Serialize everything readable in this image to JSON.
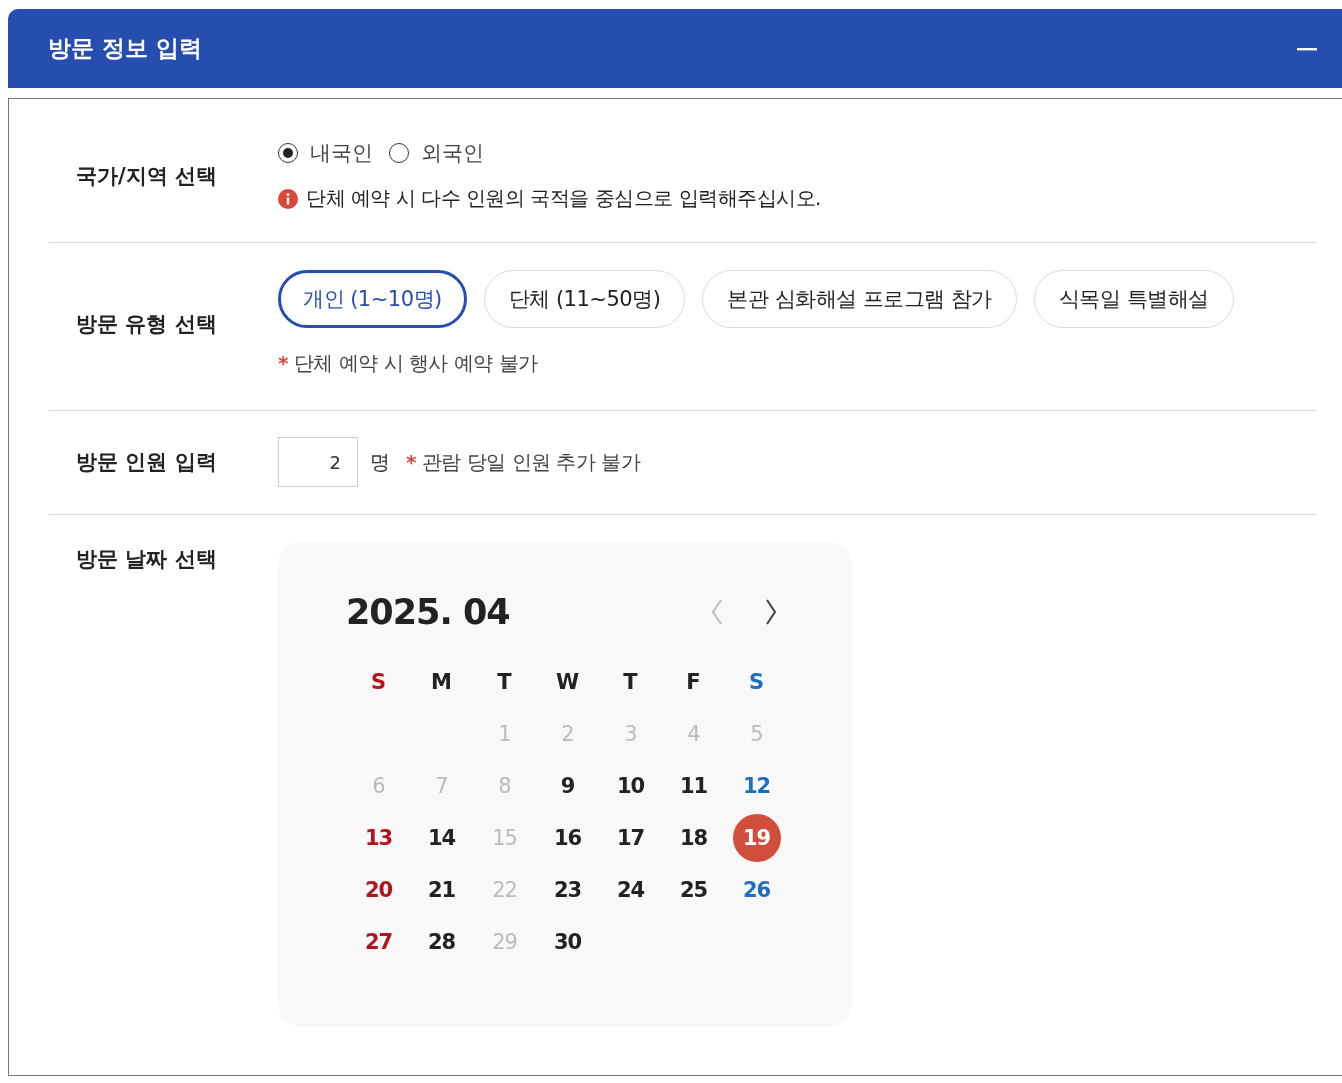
{
  "panel": {
    "title": "방문 정보 입력",
    "expanded": true
  },
  "nationality": {
    "label": "국가/지역 선택",
    "options": [
      {
        "label": "내국인",
        "selected": true
      },
      {
        "label": "외국인",
        "selected": false
      }
    ],
    "notice": "단체 예약 시 다수 인원의 국적을 중심으로 입력해주십시오."
  },
  "visit_type": {
    "label": "방문 유형 선택",
    "options": [
      {
        "label": "개인 (1~10명)",
        "selected": true
      },
      {
        "label": "단체 (11~50명)",
        "selected": false
      },
      {
        "label": "본관 심화해설 프로그램 참가",
        "selected": false
      },
      {
        "label": "식목일 특별해설",
        "selected": false
      }
    ],
    "note": {
      "marker": "*",
      "text": "단체 예약 시 행사 예약 불가"
    }
  },
  "visitors": {
    "label": "방문 인원 입력",
    "value": "2",
    "unit": "명",
    "note": {
      "marker": "*",
      "text": "관람 당일 인원 추가 불가"
    }
  },
  "visit_date": {
    "label": "방문 날짜 선택",
    "calendar": {
      "title": "2025. 04",
      "prev": {
        "disabled": true
      },
      "next": {
        "disabled": false
      },
      "weekdays": [
        {
          "label": "S",
          "kind": "sunday"
        },
        {
          "label": "M",
          "kind": "weekday"
        },
        {
          "label": "T",
          "kind": "weekday"
        },
        {
          "label": "W",
          "kind": "weekday"
        },
        {
          "label": "T",
          "kind": "weekday"
        },
        {
          "label": "F",
          "kind": "weekday"
        },
        {
          "label": "S",
          "kind": "saturday"
        }
      ],
      "days": [
        {
          "kind": "blank"
        },
        {
          "kind": "blank"
        },
        {
          "day": "1",
          "kind": "weekday",
          "disabled": true,
          "selected": false
        },
        {
          "day": "2",
          "kind": "weekday",
          "disabled": true,
          "selected": false
        },
        {
          "day": "3",
          "kind": "weekday",
          "disabled": true,
          "selected": false
        },
        {
          "day": "4",
          "kind": "weekday",
          "disabled": true,
          "selected": false
        },
        {
          "day": "5",
          "kind": "saturday",
          "disabled": true,
          "selected": false
        },
        {
          "day": "6",
          "kind": "sunday",
          "disabled": true,
          "selected": false
        },
        {
          "day": "7",
          "kind": "weekday",
          "disabled": true,
          "selected": false
        },
        {
          "day": "8",
          "kind": "weekday",
          "disabled": true,
          "selected": false
        },
        {
          "day": "9",
          "kind": "weekday",
          "disabled": false,
          "selected": false
        },
        {
          "day": "10",
          "kind": "weekday",
          "disabled": false,
          "selected": false
        },
        {
          "day": "11",
          "kind": "weekday",
          "disabled": false,
          "selected": false
        },
        {
          "day": "12",
          "kind": "saturday",
          "disabled": false,
          "selected": false
        },
        {
          "day": "13",
          "kind": "sunday",
          "disabled": false,
          "selected": false
        },
        {
          "day": "14",
          "kind": "weekday",
          "disabled": false,
          "selected": false
        },
        {
          "day": "15",
          "kind": "weekday",
          "disabled": true,
          "selected": false
        },
        {
          "day": "16",
          "kind": "weekday",
          "disabled": false,
          "selected": false
        },
        {
          "day": "17",
          "kind": "weekday",
          "disabled": false,
          "selected": false
        },
        {
          "day": "18",
          "kind": "weekday",
          "disabled": false,
          "selected": false
        },
        {
          "day": "19",
          "kind": "saturday",
          "disabled": false,
          "selected": true
        },
        {
          "day": "20",
          "kind": "sunday",
          "disabled": false,
          "selected": false
        },
        {
          "day": "21",
          "kind": "weekday",
          "disabled": false,
          "selected": false
        },
        {
          "day": "22",
          "kind": "weekday",
          "disabled": true,
          "selected": false
        },
        {
          "day": "23",
          "kind": "weekday",
          "disabled": false,
          "selected": false
        },
        {
          "day": "24",
          "kind": "weekday",
          "disabled": false,
          "selected": false
        },
        {
          "day": "25",
          "kind": "weekday",
          "disabled": false,
          "selected": false
        },
        {
          "day": "26",
          "kind": "saturday",
          "disabled": false,
          "selected": false
        },
        {
          "day": "27",
          "kind": "sunday",
          "disabled": false,
          "selected": false
        },
        {
          "day": "28",
          "kind": "weekday",
          "disabled": false,
          "selected": false
        },
        {
          "day": "29",
          "kind": "weekday",
          "disabled": true,
          "selected": false
        },
        {
          "day": "30",
          "kind": "weekday",
          "disabled": false,
          "selected": false
        }
      ]
    }
  }
}
